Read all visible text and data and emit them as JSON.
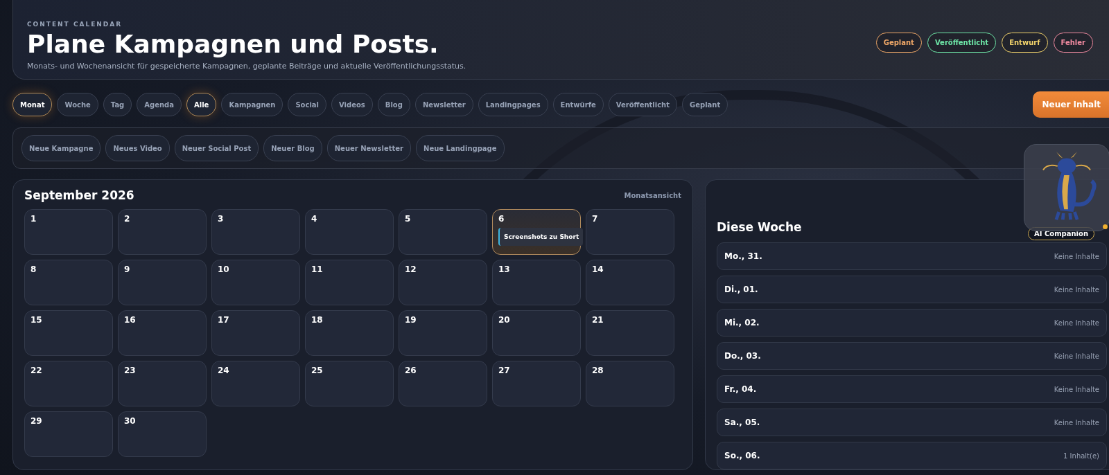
{
  "header": {
    "eyebrow": "CONTENT CALENDAR",
    "title": "Plane Kampagnen und Posts.",
    "subtitle": "Monats- und Wochenansicht für gespeicherte Kampagnen, geplante Beiträge und aktuelle Veröffentlichungsstatus.",
    "legend": [
      {
        "label": "Geplant",
        "color": "#f0a868"
      },
      {
        "label": "Veröffentlicht",
        "color": "#6ee7a8"
      },
      {
        "label": "Entwurf",
        "color": "#f2d36b"
      },
      {
        "label": "Fehler",
        "color": "#f08aa0"
      }
    ]
  },
  "view_tabs": [
    {
      "label": "Monat",
      "selected": true
    },
    {
      "label": "Woche",
      "selected": false
    },
    {
      "label": "Tag",
      "selected": false
    },
    {
      "label": "Agenda",
      "selected": false
    }
  ],
  "filters": [
    {
      "label": "Alle",
      "selected": true
    },
    {
      "label": "Kampagnen",
      "selected": false
    },
    {
      "label": "Social",
      "selected": false
    },
    {
      "label": "Videos",
      "selected": false
    },
    {
      "label": "Blog",
      "selected": false
    },
    {
      "label": "Newsletter",
      "selected": false
    },
    {
      "label": "Landingpages",
      "selected": false
    },
    {
      "label": "Entwürfe",
      "selected": false
    },
    {
      "label": "Veröffentlicht",
      "selected": false
    },
    {
      "label": "Geplant",
      "selected": false
    }
  ],
  "new_button": "Neuer Inhalt",
  "quick_create": [
    "Neue Kampagne",
    "Neues Video",
    "Neuer Social Post",
    "Neuer Blog",
    "Neuer Newsletter",
    "Neue Landingpage"
  ],
  "month": {
    "title": "September 2026",
    "view_label": "Monatsansicht",
    "days": [
      {
        "day": "1",
        "selected": false
      },
      {
        "day": "2",
        "selected": false
      },
      {
        "day": "3",
        "selected": false
      },
      {
        "day": "4",
        "selected": false
      },
      {
        "day": "5",
        "selected": false
      },
      {
        "day": "6",
        "selected": true,
        "events": [
          {
            "title": "Screenshots zu Short",
            "color": "#3fb6e0"
          }
        ]
      },
      {
        "day": "7",
        "selected": false
      },
      {
        "day": "8",
        "selected": false
      },
      {
        "day": "9",
        "selected": false
      },
      {
        "day": "10",
        "selected": false
      },
      {
        "day": "11",
        "selected": false
      },
      {
        "day": "12",
        "selected": false
      },
      {
        "day": "13",
        "selected": false
      },
      {
        "day": "14",
        "selected": false
      },
      {
        "day": "15",
        "selected": false
      },
      {
        "day": "16",
        "selected": false
      },
      {
        "day": "17",
        "selected": false
      },
      {
        "day": "18",
        "selected": false
      },
      {
        "day": "19",
        "selected": false
      },
      {
        "day": "20",
        "selected": false
      },
      {
        "day": "21",
        "selected": false
      },
      {
        "day": "22",
        "selected": false
      },
      {
        "day": "23",
        "selected": false
      },
      {
        "day": "24",
        "selected": false
      },
      {
        "day": "25",
        "selected": false
      },
      {
        "day": "26",
        "selected": false
      },
      {
        "day": "27",
        "selected": false
      },
      {
        "day": "28",
        "selected": false
      },
      {
        "day": "29",
        "selected": false
      },
      {
        "day": "30",
        "selected": false
      }
    ]
  },
  "week": {
    "title": "Diese Woche",
    "days": [
      {
        "label": "Mo., 31.",
        "count": "Keine Inhalte"
      },
      {
        "label": "Di., 01.",
        "count": "Keine Inhalte"
      },
      {
        "label": "Mi., 02.",
        "count": "Keine Inhalte"
      },
      {
        "label": "Do., 03.",
        "count": "Keine Inhalte"
      },
      {
        "label": "Fr., 04.",
        "count": "Keine Inhalte"
      },
      {
        "label": "Sa., 05.",
        "count": "Keine Inhalte"
      },
      {
        "label": "So., 06.",
        "count": "1 Inhalt(e)"
      }
    ]
  },
  "companion": {
    "label": "AI Companion"
  }
}
